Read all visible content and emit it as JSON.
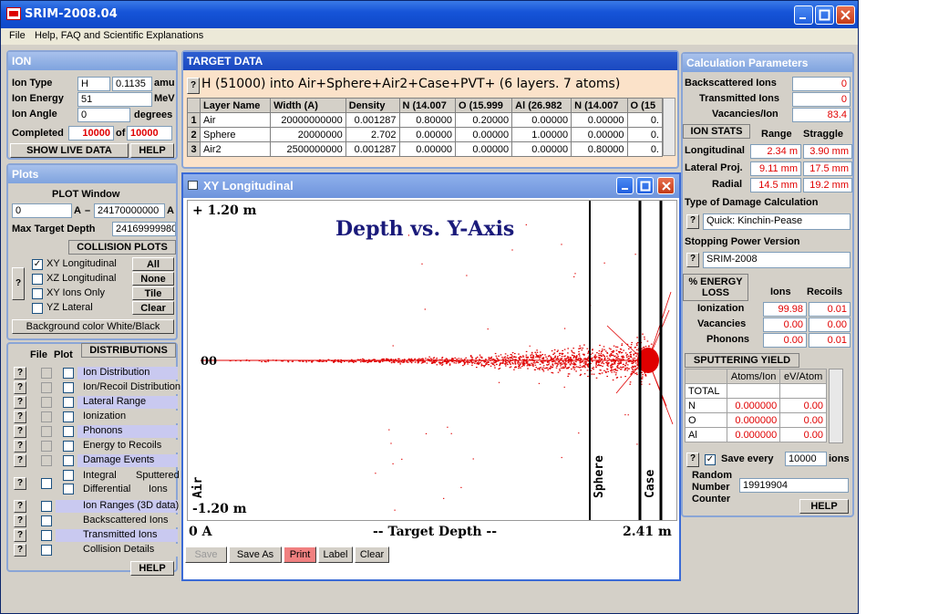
{
  "window": {
    "title": "SRIM-2008.04"
  },
  "menu": [
    "File",
    "Help, FAQ and Scientific Explanations"
  ],
  "ion": {
    "title": "ION",
    "type_label": "Ion Type",
    "type_value": "H",
    "mass_value": "0.1135",
    "mass_unit": "amu",
    "energy_label": "Ion Energy",
    "energy_value": "51",
    "energy_unit": "MeV",
    "angle_label": "Ion Angle",
    "angle_value": "0",
    "angle_unit": "degrees",
    "completed_label": "Completed",
    "completed_value": "10000",
    "of_label": "of",
    "total_value": "10000",
    "show_live_label": "SHOW LIVE DATA",
    "help_label": "HELP"
  },
  "target": {
    "title": "TARGET DATA",
    "description": "H (51000) into Air+Sphere+Air2+Case+PVT+ (6 layers. 7 atoms)",
    "columns": [
      "Layer Name",
      "Width (A)",
      "Density",
      "N (14.007",
      "O (15.999",
      "Al (26.982",
      "N (14.007",
      "O (15"
    ],
    "rows": [
      {
        "num": "1",
        "name": "Air",
        "width": "20000000000",
        "density": "0.001287",
        "c1": "0.80000",
        "c2": "0.20000",
        "c3": "0.00000",
        "c4": "0.00000",
        "c5": "0."
      },
      {
        "num": "2",
        "name": "Sphere",
        "width": "20000000",
        "density": "2.702",
        "c1": "0.00000",
        "c2": "0.00000",
        "c3": "1.00000",
        "c4": "0.00000",
        "c5": "0."
      },
      {
        "num": "3",
        "name": "Air2",
        "width": "2500000000",
        "density": "0.001287",
        "c1": "0.00000",
        "c2": "0.00000",
        "c3": "0.00000",
        "c4": "0.80000",
        "c5": "0."
      }
    ]
  },
  "plots": {
    "title": "Plots",
    "plot_window_label": "PLOT  Window",
    "from_value": "0",
    "to_value": "24170000000",
    "unit": "A",
    "dash": "–",
    "max_depth_label": "Max Target Depth",
    "max_depth_value": "24169999980",
    "collision_title": "COLLISION PLOTS",
    "options": [
      "XY Longitudinal",
      "XZ Longitudinal",
      "XY Ions Only",
      "YZ Lateral"
    ],
    "buttons": [
      "All",
      "None",
      "Tile",
      "Clear"
    ],
    "background_label": "Background color White/Black"
  },
  "distributions": {
    "file_label": "File",
    "plot_label": "Plot",
    "title": "DISTRIBUTIONS",
    "items": [
      "Ion Distribution",
      "Ion/Recoil Distribution",
      "Lateral Range",
      "Ionization",
      "Phonons",
      "Energy to Recoils",
      "Damage Events"
    ],
    "integral_label": "Integral",
    "differential_label": "Differential",
    "sputtered_label": "Sputtered",
    "ions_label": "Ions",
    "items2": [
      "Ion Ranges (3D data)",
      "Backscattered Ions",
      "Transmitted Ions",
      "Collision Details"
    ],
    "help_label": "HELP"
  },
  "xy_plot": {
    "title": "XY Longitudinal",
    "chart_title": "Depth vs. Y-Axis",
    "y_top": "+ 1.20 m",
    "y_bottom": "-1.20 m",
    "y_zero": "00",
    "x_left": "0 A",
    "x_center": "-- Target Depth --",
    "x_right": "2.41 m",
    "layer_labels": [
      "Air",
      "Sphere",
      "Case"
    ],
    "toolbar": [
      "Save",
      "Save As",
      "Print",
      "Label",
      "Clear"
    ]
  },
  "calc": {
    "title": "Calculation Parameters",
    "backscattered_label": "Backscattered Ions",
    "backscattered_value": "0",
    "transmitted_label": "Transmitted Ions",
    "transmitted_value": "0",
    "vacancies_label": "Vacancies/Ion",
    "vacancies_value": "83.4",
    "stats_title": "ION STATS",
    "range_label": "Range",
    "straggle_label": "Straggle",
    "longitudinal_label": "Longitudinal",
    "longitudinal_range": "2.34 m",
    "longitudinal_straggle": "3.90 mm",
    "lateral_label": "Lateral Proj.",
    "lateral_range": "9.11 mm",
    "lateral_straggle": "17.5 mm",
    "radial_label": "Radial",
    "radial_range": "14.5 mm",
    "radial_straggle": "19.2 mm",
    "damage_title": "Type of Damage Calculation",
    "damage_value": "Quick: Kinchin-Pease",
    "stopping_title": "Stopping Power Version",
    "stopping_value": "SRIM-2008",
    "energy_title": "% ENERGY LOSS",
    "ions_label": "Ions",
    "recoils_label": "Recoils",
    "ionization_label": "Ionization",
    "ionization_ions": "99.98",
    "ionization_recoils": "0.01",
    "vacancies2_label": "Vacancies",
    "vacancies_ions": "0.00",
    "vacancies_recoils": "0.00",
    "phonons_label": "Phonons",
    "phonons_ions": "0.00",
    "phonons_recoils": "0.01",
    "sputter_title": "SPUTTERING YIELD",
    "atoms_label": "Atoms/Ion",
    "ev_label": "eV/Atom",
    "sputter_rows": [
      {
        "el": "TOTAL",
        "a": "",
        "e": ""
      },
      {
        "el": "N",
        "a": "0.000000",
        "e": "0.00"
      },
      {
        "el": "O",
        "a": "0.000000",
        "e": "0.00"
      },
      {
        "el": "Al",
        "a": "0.000000",
        "e": "0.00"
      }
    ],
    "save_every_label": "Save every",
    "save_every_value": "10000",
    "save_ions": "ions",
    "random_label": "Random",
    "number_label": "Number",
    "counter_label": "Counter",
    "random_value": "19919904",
    "help_label": "HELP"
  }
}
